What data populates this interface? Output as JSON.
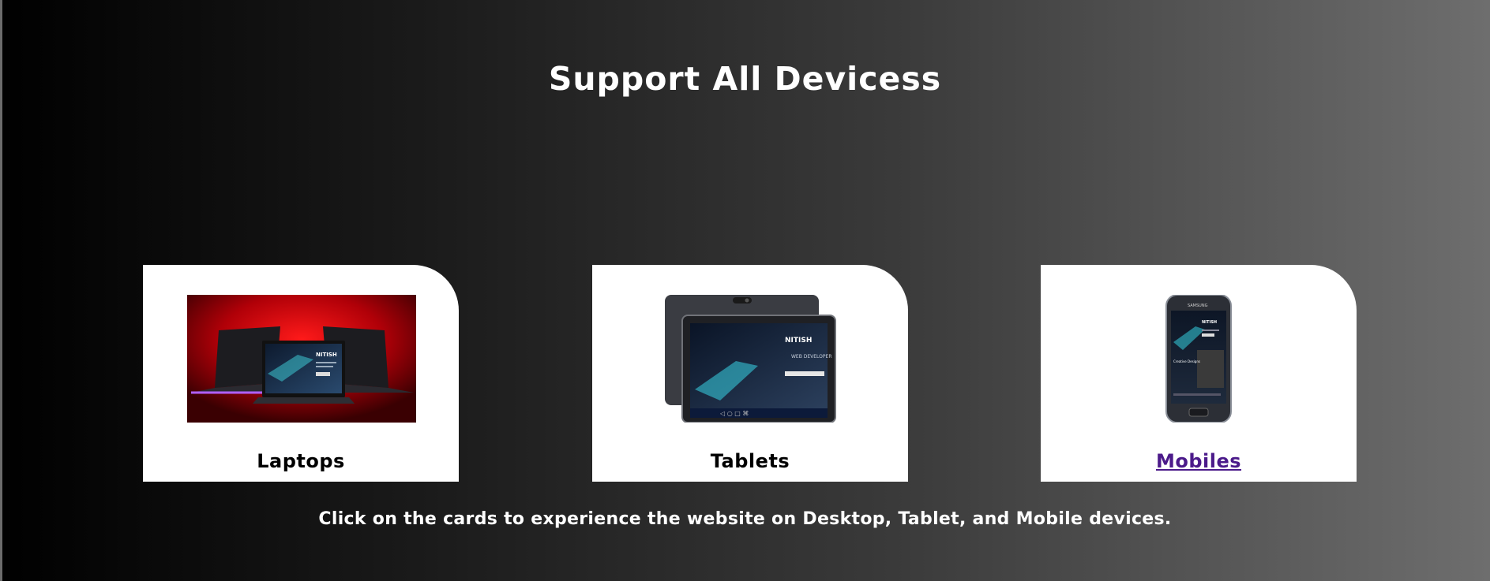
{
  "header": {
    "title": "Support All Devicess"
  },
  "cards": [
    {
      "label": "Laptops",
      "image_icon": "laptops-image"
    },
    {
      "label": "Tablets",
      "image_icon": "tablets-image"
    },
    {
      "label": "Mobiles",
      "image_icon": "mobile-image"
    }
  ],
  "screen_text": {
    "brand": "NITISH",
    "headline": "WEB DEVELOPER",
    "mobile_tagline": "Creative Designs",
    "phone_brand": "SAMSUNG"
  },
  "footer": {
    "caption": "Click on the cards to experience the website on Desktop, Tablet, and Mobile devices."
  },
  "colors": {
    "background_start": "#000000",
    "background_end": "#6e6e6e",
    "card_bg": "#ffffff",
    "visited_link": "#4b1a8a",
    "laptop_bg_red": "#c0000a"
  }
}
